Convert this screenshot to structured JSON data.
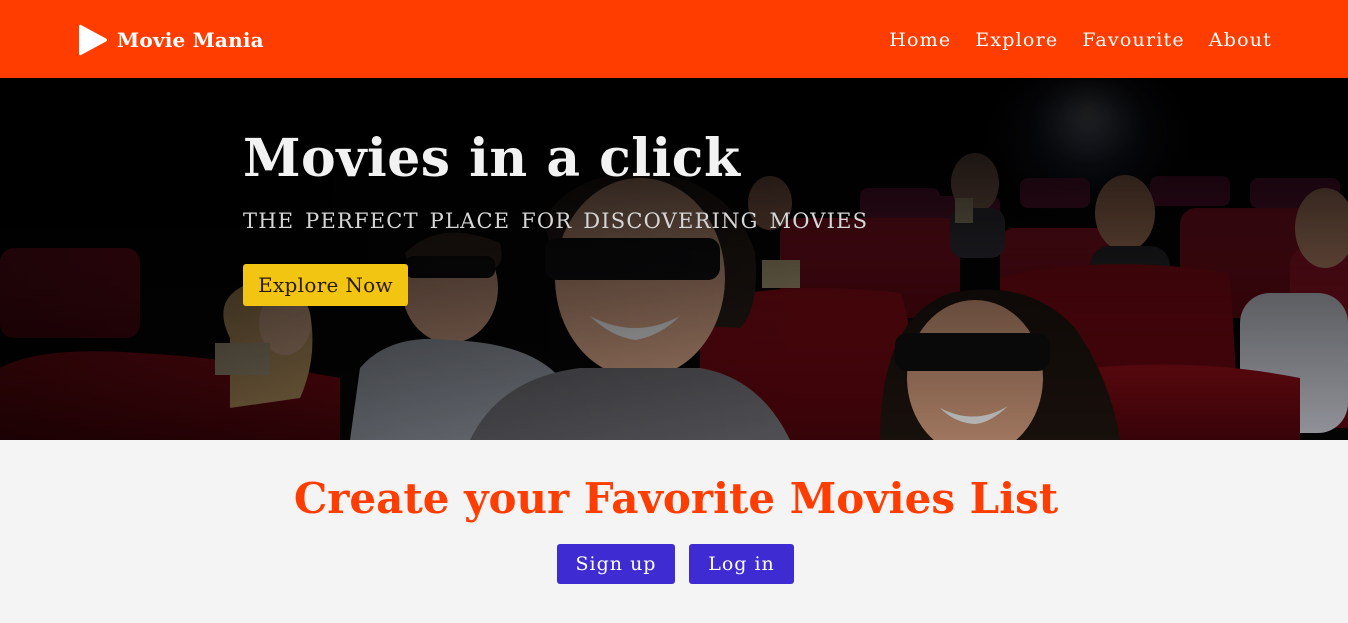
{
  "navbar": {
    "brand_name": "Movie Mania",
    "brand_icon": "play-icon",
    "links": [
      "Home",
      "Explore",
      "Favourite",
      "About"
    ]
  },
  "hero": {
    "title": "Movies in a click",
    "tagline": "THE PERFECT PLACE FOR DISCOVERING MOVIES",
    "button_label": "Explore Now"
  },
  "cta": {
    "title": "Create your Favorite Movies List",
    "signup_label": "Sign up",
    "login_label": "Log in"
  },
  "colors": {
    "navbar_bg": "#ff3d00",
    "accent": "#ff3d00",
    "explore_button_bg": "#f2c513",
    "auth_button_bg": "#3e2bd1",
    "page_bg": "#f4f4f4"
  }
}
